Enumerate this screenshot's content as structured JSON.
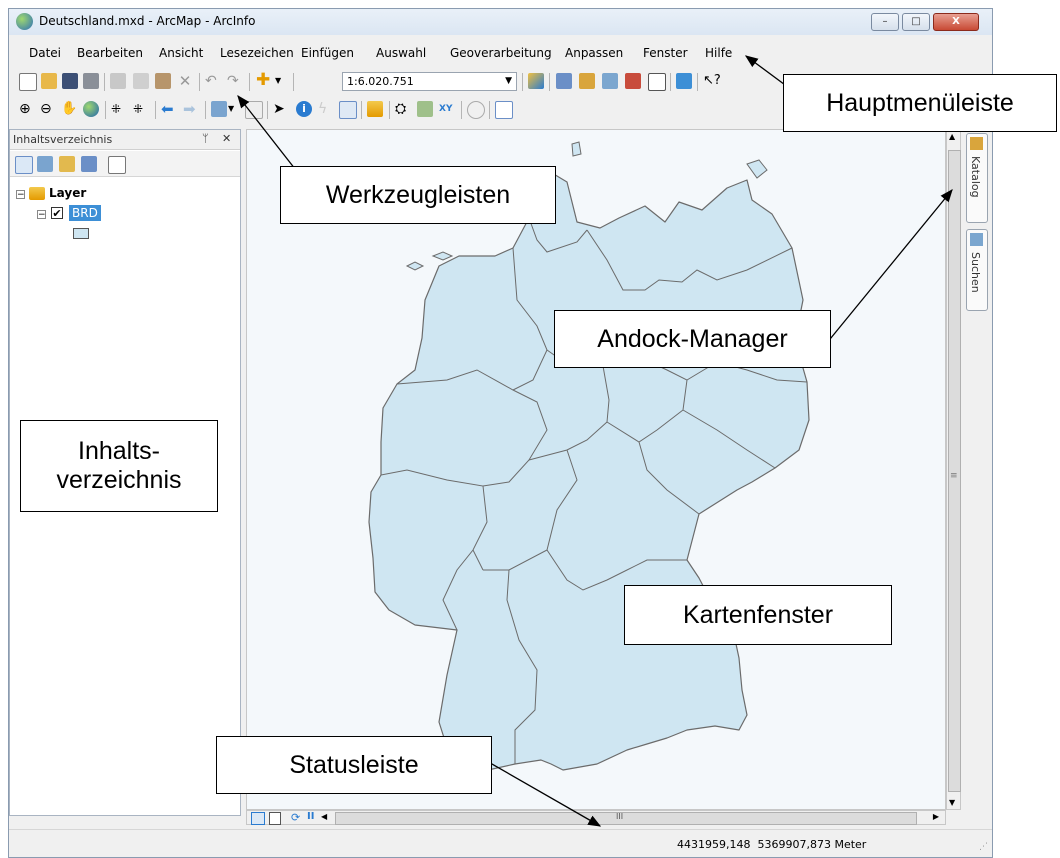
{
  "window": {
    "title": "Deutschland.mxd - ArcMap - ArcInfo",
    "controls": {
      "minimize": "–",
      "maximize": "□",
      "close": "X"
    }
  },
  "menu": [
    "Datei",
    "Bearbeiten",
    "Ansicht",
    "Lesezeichen",
    "Einfügen",
    "Auswahl",
    "Geoverarbeitung",
    "Anpassen",
    "Fenster",
    "Hilfe"
  ],
  "toolbar": {
    "scale_value": "1:6.020.751"
  },
  "toc": {
    "title": "Inhaltsverzeichnis",
    "pin": "ᛘ",
    "close": "✕",
    "layer_group": "Layer",
    "layer_name": "BRD"
  },
  "dock_tabs": [
    "Katalog",
    "Suchen"
  ],
  "status": {
    "coordinates": "4431959,148  5369907,873 Meter"
  },
  "hscroll_thumb": "III",
  "vscroll_thumb": "≡",
  "callouts": {
    "menu": "Hauptmenüleiste",
    "toolbars": "Werkzeugleisten",
    "dock": "Andock-Manager",
    "toc": "Inhalts-\nverzeichnis",
    "map": "Kartenfenster",
    "status": "Statusleiste"
  },
  "colors": {
    "map_fill": "#cfe6f2",
    "map_stroke": "#6b6b6b",
    "selected_layer": "#3d8fd6"
  }
}
